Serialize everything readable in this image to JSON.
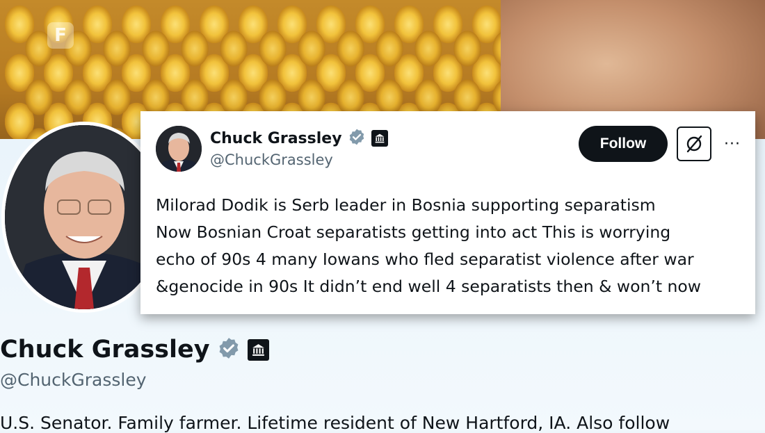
{
  "watermark": {
    "label": "F"
  },
  "profile": {
    "name": "Chuck Grassley",
    "handle": "@ChuckGrassley",
    "bio": "U.S. Senator. Family farmer. Lifetime resident of New Hartford, IA. Also follow"
  },
  "tweet": {
    "author_name": "Chuck Grassley",
    "author_handle": "@ChuckGrassley",
    "follow_label": "Follow",
    "more_label": "···",
    "lines": [
      "Milorad Dodik is Serb leader in Bosnia supporting separatism",
      "Now Bosnian Croat separatists getting into act This is worrying",
      "echo of 90s 4 many Iowans who fled separatist violence after war",
      "&genocide in 90s It didn’t end well 4 separatists then & won’t now"
    ]
  },
  "icons": {
    "verified": "verified-badge-icon",
    "government": "government-building-icon",
    "grok": "grok-icon",
    "more": "more-options-icon"
  },
  "colors": {
    "verified_badge": "#829aab",
    "follow_bg": "#0f1419",
    "handle_text": "#536471"
  }
}
